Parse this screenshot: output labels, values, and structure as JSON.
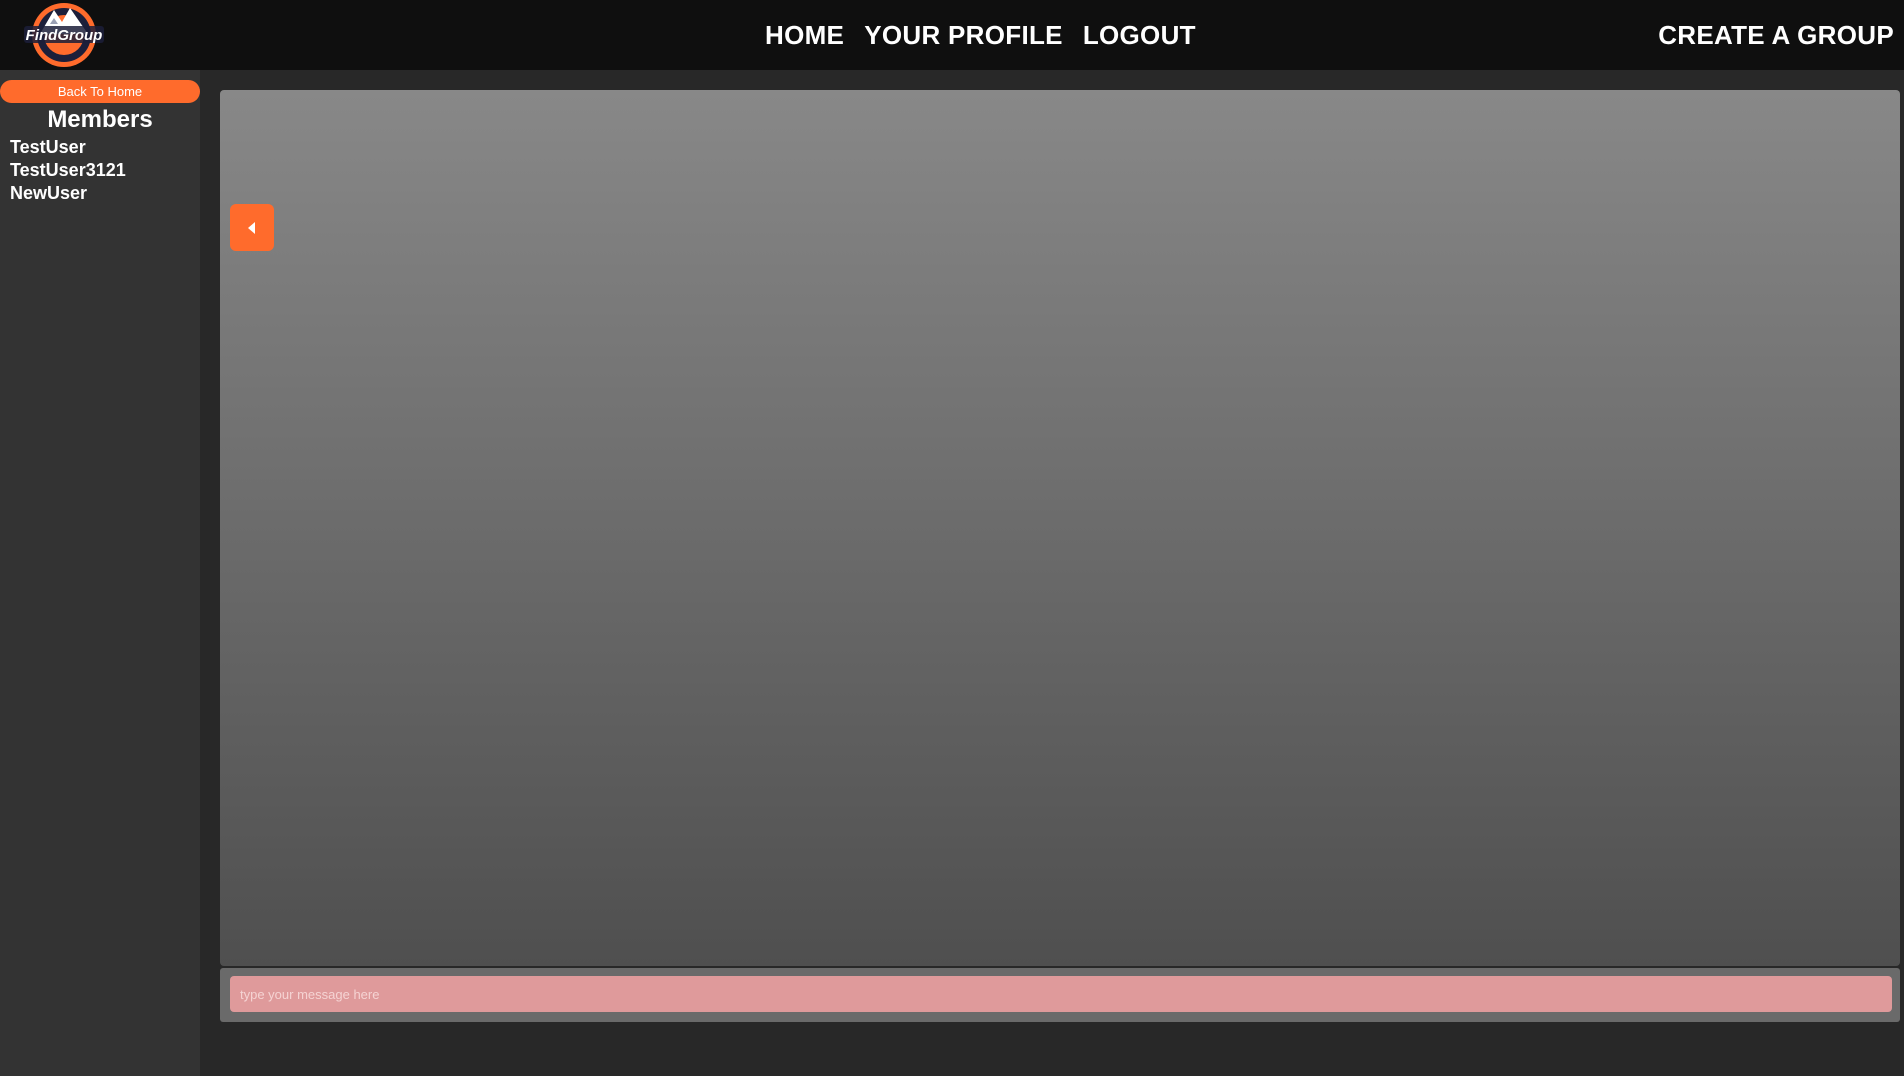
{
  "header": {
    "logo_text": "FindGroup",
    "nav": {
      "home": "HOME",
      "profile": "YOUR PROFILE",
      "logout": "LOGOUT"
    },
    "create_group": "CREATE A GROUP"
  },
  "sidebar": {
    "back_button": "Back To Home",
    "members_title": "Members",
    "members": [
      "TestUser",
      "TestUser3121",
      "NewUser"
    ]
  },
  "chat": {
    "input_placeholder": "type your message here",
    "input_value": ""
  },
  "colors": {
    "accent": "#ff6b2c",
    "topbar": "#0f0f0f",
    "sidebar": "#333333",
    "input_bg": "#df9a9b"
  },
  "icons": {
    "collapse": "caret-left-icon",
    "logo": "mountain-logo-icon"
  }
}
